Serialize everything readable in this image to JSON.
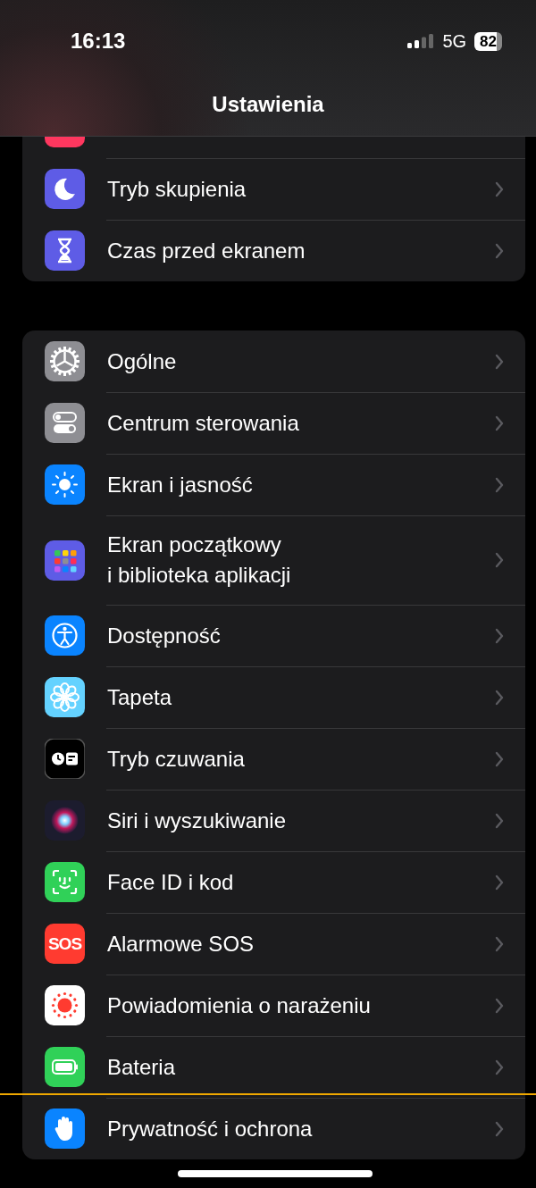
{
  "status_bar": {
    "time": "16:13",
    "network": "5G",
    "battery": "82"
  },
  "title": "Ustawienia",
  "groups": [
    {
      "rows": [
        {
          "kind": "cut"
        },
        {
          "kind": "row",
          "label": "Tryb skupienia"
        },
        {
          "kind": "row",
          "label": "Czas przed ekranem"
        }
      ]
    },
    {
      "rows": [
        {
          "kind": "row",
          "label": "Ogólne"
        },
        {
          "kind": "row",
          "label": "Centrum sterowania"
        },
        {
          "kind": "row",
          "label": "Ekran i jasność"
        },
        {
          "kind": "row",
          "label": "Ekran początkowy\ni biblioteka aplikacji"
        },
        {
          "kind": "row",
          "label": "Dostępność"
        },
        {
          "kind": "row",
          "label": "Tapeta"
        },
        {
          "kind": "row",
          "label": "Tryb czuwania"
        },
        {
          "kind": "row",
          "label": "Siri i wyszukiwanie"
        },
        {
          "kind": "row",
          "label": "Face ID i kod"
        },
        {
          "kind": "row",
          "label": "Alarmowe SOS",
          "icon_text": "SOS"
        },
        {
          "kind": "row",
          "label": "Powiadomienia o narażeniu"
        },
        {
          "kind": "row",
          "label": "Bateria"
        },
        {
          "kind": "row",
          "label": "Prywatność i ochrona"
        }
      ]
    }
  ]
}
